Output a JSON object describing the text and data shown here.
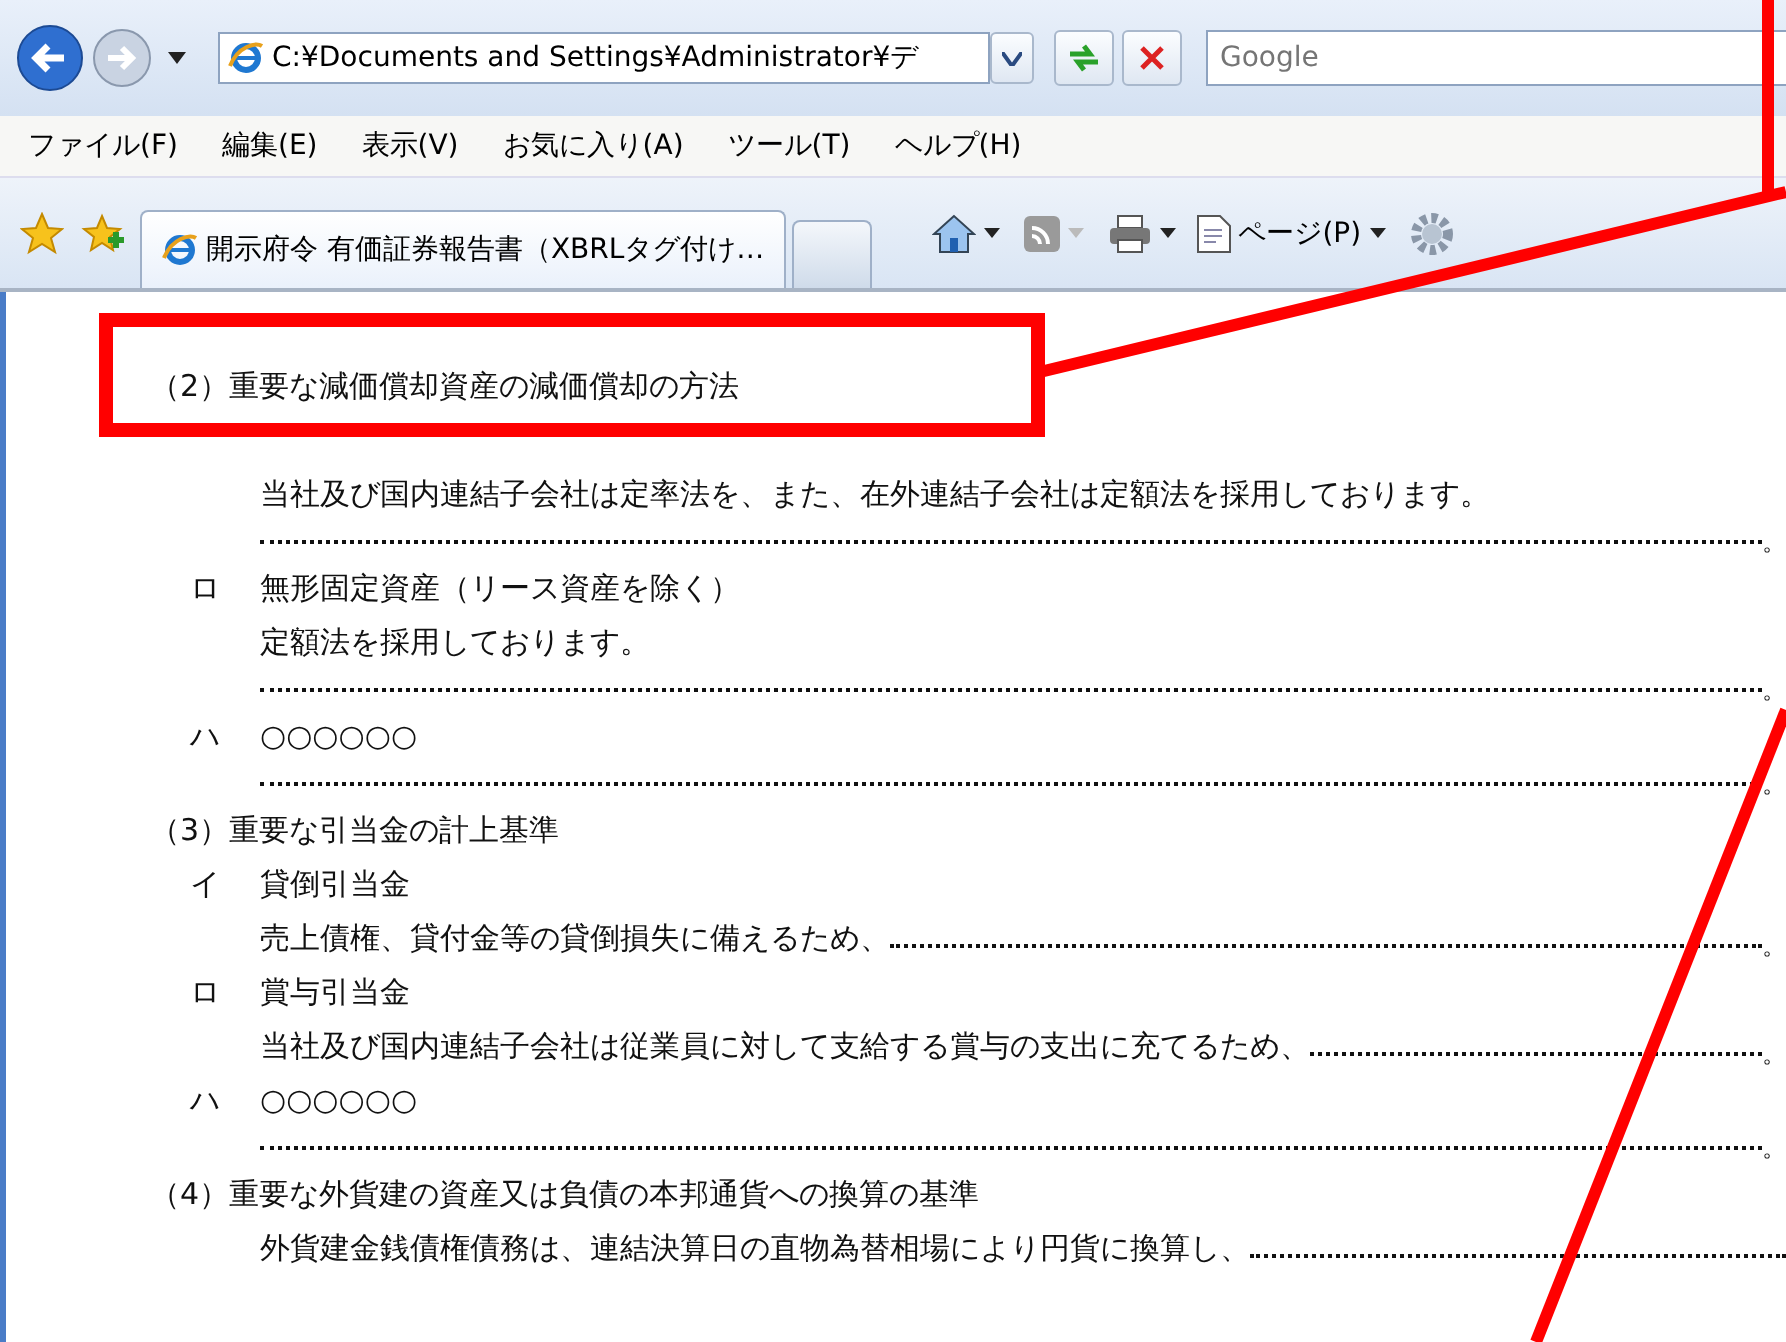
{
  "toolbar": {
    "address": "C:¥Documents and Settings¥Administrator¥デ",
    "search": {
      "placeholder": "Google"
    }
  },
  "menu": [
    "ファイル(F)",
    "編集(E)",
    "表示(V)",
    "お気に入り(A)",
    "ツール(T)",
    "ヘルプ(H)"
  ],
  "tabs": [
    {
      "label": "開示府令 有価証券報告書（XBRLタグ付け…",
      "selected": true
    }
  ],
  "command_bar": {
    "page": "ページ(P)"
  },
  "sections": [
    {
      "heading": "（2）重要な減価償却資産の減価償却の方法",
      "items": [
        {
          "lines": [
            {
              "kind": "text",
              "text": "当社及び国内連結子会社は定率法を、また、在外連結子会社は定額法を採用しております。"
            },
            {
              "kind": "leader",
              "end": "。"
            }
          ]
        },
        {
          "mark": "ロ",
          "title": "無形固定資産（リース資産を除く）",
          "lines": [
            {
              "kind": "text",
              "text": "定額法を採用しております。"
            },
            {
              "kind": "leader",
              "end": "。"
            }
          ]
        },
        {
          "mark": "ハ",
          "title": "○○○○○○",
          "lines": [
            {
              "kind": "leader",
              "end": "。"
            }
          ]
        }
      ]
    },
    {
      "heading": "（3）重要な引当金の計上基準",
      "items": [
        {
          "mark": "イ",
          "title": "貸倒引当金",
          "lines": [
            {
              "kind": "text_leader",
              "text": "売上債権、貸付金等の貸倒損失に備えるため、",
              "end": "。"
            }
          ]
        },
        {
          "mark": "ロ",
          "title": "賞与引当金",
          "lines": [
            {
              "kind": "text_leader",
              "text": "当社及び国内連結子会社は従業員に対して支給する賞与の支出に充てるため、",
              "end": "。"
            }
          ]
        },
        {
          "mark": "ハ",
          "title": "○○○○○○",
          "lines": [
            {
              "kind": "leader",
              "end": "。"
            }
          ]
        }
      ]
    },
    {
      "heading": "（4）重要な外貨建の資産又は負債の本邦通貨への換算の基準",
      "lines": [
        {
          "kind": "text_leader",
          "text": "外貨建金銭債権債務は、連結決算日の直物為替相場により円貨に換算し、"
        }
      ]
    }
  ]
}
